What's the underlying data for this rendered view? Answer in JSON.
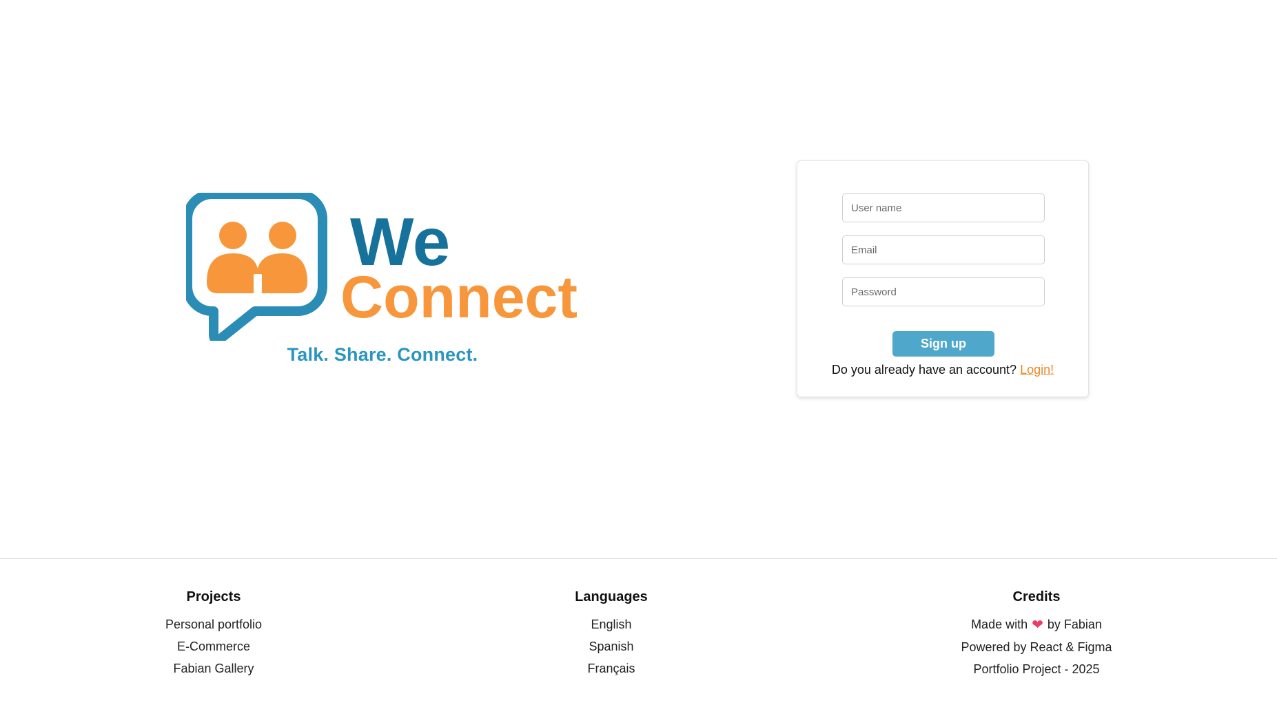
{
  "brand": {
    "word1": "We",
    "word2": "Connect",
    "tagline": "Talk. Share. Connect.",
    "colors": {
      "blue": "#2b8cb6",
      "dark_blue": "#17729b",
      "orange": "#f7963a"
    }
  },
  "signup_form": {
    "username_placeholder": "User name",
    "email_placeholder": "Email",
    "password_placeholder": "Password",
    "submit_label": "Sign up",
    "account_prompt": "Do you already have an account?",
    "login_link": "Login!",
    "button_color": "#4fa8cb",
    "link_color": "#e88a26"
  },
  "footer": {
    "projects": {
      "title": "Projects",
      "items": [
        "Personal portfolio",
        "E-Commerce",
        "Fabian Gallery"
      ]
    },
    "languages": {
      "title": "Languages",
      "items": [
        "English",
        "Spanish",
        "Français"
      ]
    },
    "credits": {
      "title": "Credits",
      "made_with_prefix": "Made with",
      "heart_icon": "heart-icon",
      "made_with_suffix": "by Fabian",
      "powered_by": "Powered by React & Figma",
      "project_year": "Portfolio Project - 2025"
    }
  }
}
